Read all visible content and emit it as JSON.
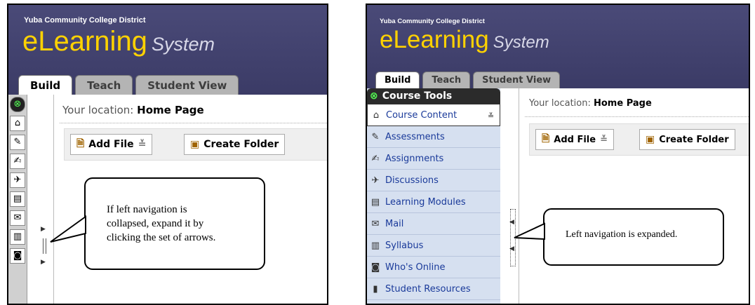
{
  "app": {
    "district": "Yuba Community College District",
    "logo_main": "eLearning",
    "logo_sub": "System"
  },
  "tabs": [
    "Build",
    "Teach",
    "Student View"
  ],
  "location": {
    "label": "Your location:",
    "value": "Home Page"
  },
  "toolbar": {
    "add_file": "Add File",
    "create_folder": "Create Folder"
  },
  "left_panel": {
    "callout_lines": [
      "If left navigation is",
      "collapsed, expand it by",
      "clicking the set of arrows."
    ]
  },
  "right_panel": {
    "nav_title": "Course Tools",
    "nav_items": [
      {
        "label": "Course Content",
        "icon": "home-icon"
      },
      {
        "label": "Assessments",
        "icon": "assessments-icon"
      },
      {
        "label": "Assignments",
        "icon": "assignments-icon"
      },
      {
        "label": "Discussions",
        "icon": "discussions-icon"
      },
      {
        "label": "Learning Modules",
        "icon": "modules-icon"
      },
      {
        "label": "Mail",
        "icon": "mail-icon"
      },
      {
        "label": "Syllabus",
        "icon": "syllabus-icon"
      },
      {
        "label": "Who's Online",
        "icon": "whos-online-icon"
      },
      {
        "label": "Student Resources",
        "icon": "resources-icon"
      }
    ],
    "callout": "Left navigation is expanded."
  }
}
